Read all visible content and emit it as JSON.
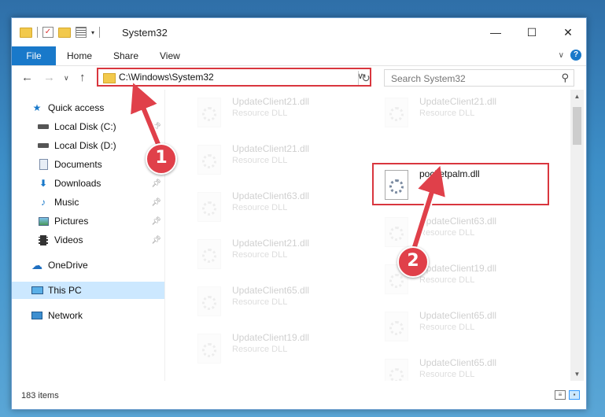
{
  "window": {
    "title": "System32"
  },
  "ribbon": {
    "tabs": [
      "File",
      "Home",
      "Share",
      "View"
    ],
    "help": "?"
  },
  "address": {
    "path": "C:\\Windows\\System32"
  },
  "search": {
    "placeholder": "Search System32"
  },
  "nav_pane": {
    "items": [
      {
        "label": "Quick access",
        "icon": "star-icon"
      },
      {
        "label": "Local Disk (C:)",
        "icon": "drive-icon",
        "pinned": true
      },
      {
        "label": "Local Disk (D:)",
        "icon": "drive-icon"
      },
      {
        "label": "Documents",
        "icon": "documents-icon"
      },
      {
        "label": "Downloads",
        "icon": "download-arrow-icon",
        "pinned": true
      },
      {
        "label": "Music",
        "icon": "music-note-icon",
        "pinned": true
      },
      {
        "label": "Pictures",
        "icon": "pictures-icon",
        "pinned": true
      },
      {
        "label": "Videos",
        "icon": "film-icon",
        "pinned": true
      },
      {
        "label": "OneDrive",
        "icon": "cloud-icon"
      },
      {
        "label": "This PC",
        "icon": "computer-icon",
        "selected": true
      },
      {
        "label": "Network",
        "icon": "network-icon"
      }
    ]
  },
  "files": {
    "left": [
      {
        "name": "UpdateClient21.dll",
        "type": "Resource DLL"
      },
      {
        "name": "UpdateClient21.dll",
        "type": "Resource DLL"
      },
      {
        "name": "UpdateClient63.dll",
        "type": "Resource DLL"
      },
      {
        "name": "UpdateClient21.dll",
        "type": "Resource DLL"
      },
      {
        "name": "UpdateClient65.dll",
        "type": "Resource DLL"
      },
      {
        "name": "UpdateClient19.dll",
        "type": "Resource DLL"
      }
    ],
    "right": [
      {
        "name": "UpdateClient21.dll",
        "type": "Resource DLL"
      },
      {
        "name": "pocketpalm.dll",
        "type": ""
      },
      {
        "name": "UpdateClient63.dll",
        "type": "Resource DLL"
      },
      {
        "name": "UpdateClient19.dll",
        "type": "Resource DLL"
      },
      {
        "name": "UpdateClient65.dll",
        "type": "Resource DLL"
      },
      {
        "name": "UpdateClient65.dll",
        "type": "Resource DLL"
      }
    ]
  },
  "status": {
    "item_count": "183 items"
  },
  "callouts": {
    "first": "1",
    "second": "2"
  },
  "colors": {
    "accent": "#1979ca",
    "highlight": "#d9363e"
  }
}
